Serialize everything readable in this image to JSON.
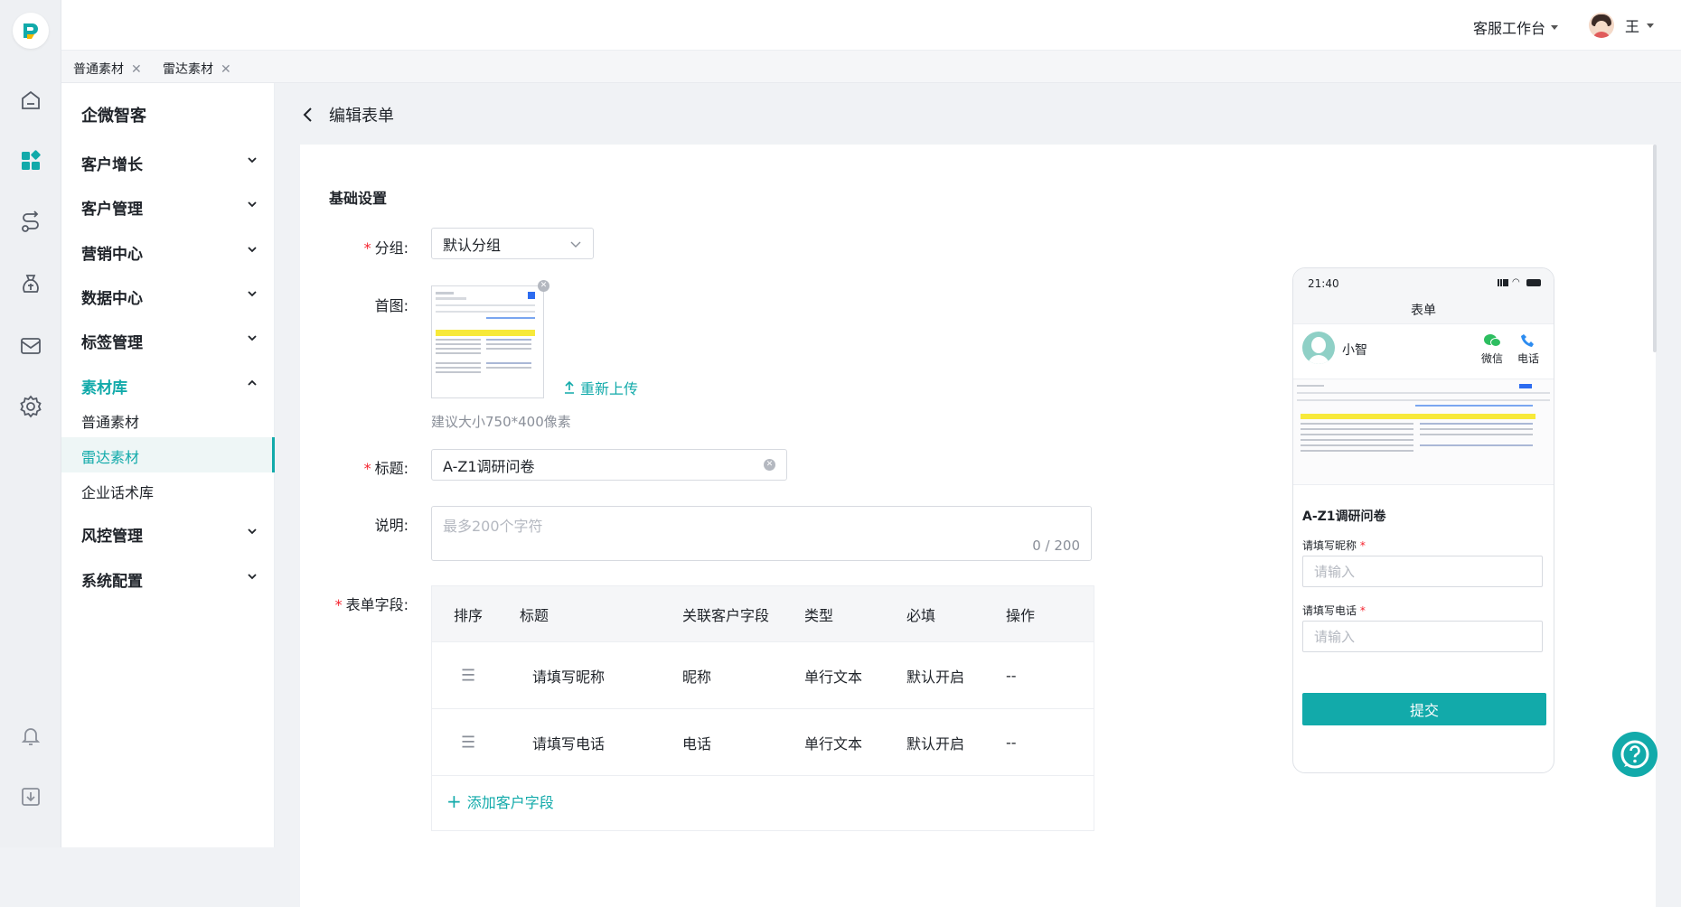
{
  "topbar": {
    "workspace": "客服工作台",
    "user": "王"
  },
  "tabs": [
    {
      "label": "普通素材"
    },
    {
      "label": "雷达素材"
    }
  ],
  "sidebar": {
    "title": "企微智客",
    "groups": [
      "客户增长",
      "客户管理",
      "营销中心",
      "数据中心",
      "标签管理",
      "素材库",
      "风控管理",
      "系统配置"
    ],
    "sub_items": [
      "普通素材",
      "雷达素材",
      "企业话术库"
    ]
  },
  "page": {
    "title": "编辑表单"
  },
  "form": {
    "section_title": "基础设置",
    "group_label": "分组:",
    "group_value": "默认分组",
    "cover_label": "首图:",
    "reupload": "重新上传",
    "cover_hint": "建议大小750*400像素",
    "title_label": "标题:",
    "title_value": "A-Z1调研问卷",
    "desc_label": "说明:",
    "desc_placeholder": "最多200个字符",
    "desc_count": "0 / 200",
    "fields_label": "表单字段:",
    "table_headers": [
      "排序",
      "标题",
      "关联客户字段",
      "类型",
      "必填",
      "操作"
    ],
    "rows": [
      {
        "title": "请填写昵称",
        "field": "昵称",
        "type": "单行文本",
        "required": "默认开启",
        "op": "--"
      },
      {
        "title": "请填写电话",
        "field": "电话",
        "type": "单行文本",
        "required": "默认开启",
        "op": "--"
      }
    ],
    "add_field": "添加客户字段"
  },
  "preview": {
    "time": "21:40",
    "header": "表单",
    "name": "小智",
    "wechat": "微信",
    "phone": "电话",
    "form_title": "A-Z1调研问卷",
    "field1_label": "请填写昵称",
    "field2_label": "请填写电话",
    "input_placeholder": "请输入",
    "submit": "提交"
  },
  "colors": {
    "accent": "#12aaaa",
    "required": "#f5222d",
    "wechat": "#2dbe60",
    "phone": "#2d8cf0"
  }
}
